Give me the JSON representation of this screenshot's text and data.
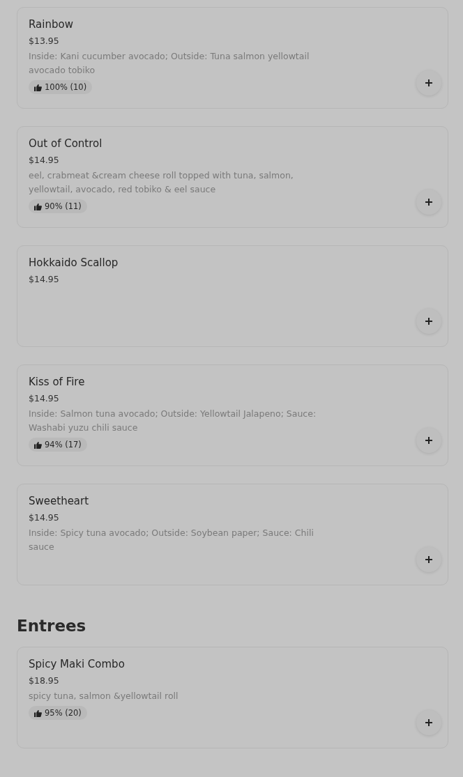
{
  "sections": [
    {
      "items": [
        {
          "name": "Rainbow",
          "price": "$13.95",
          "description": "Inside: Kani cucumber avocado; Outside: Tuna salmon yellowtail avocado tobiko",
          "rating": "100% (10)"
        },
        {
          "name": "Out of Control",
          "price": "$14.95",
          "description": "eel, crabmeat &cream cheese roll topped with tuna, salmon, yellowtail, avocado, red tobiko & eel sauce",
          "rating": "90% (11)"
        },
        {
          "name": "Hokkaido Scallop",
          "price": "$14.95"
        },
        {
          "name": "Kiss of Fire",
          "price": "$14.95",
          "description": "Inside: Salmon tuna avocado; Outside: Yellowtail Jalapeno; Sauce: Washabi yuzu chili sauce",
          "rating": "94% (17)"
        },
        {
          "name": "Sweetheart",
          "price": "$14.95",
          "description": "Inside: Spicy tuna avocado; Outside: Soybean paper; Sauce: Chili sauce"
        }
      ]
    },
    {
      "heading": "Entrees",
      "items": [
        {
          "name": "Spicy Maki Combo",
          "price": "$18.95",
          "description": "spicy tuna, salmon &yellowtail roll",
          "rating": "95% (20)"
        }
      ]
    }
  ]
}
